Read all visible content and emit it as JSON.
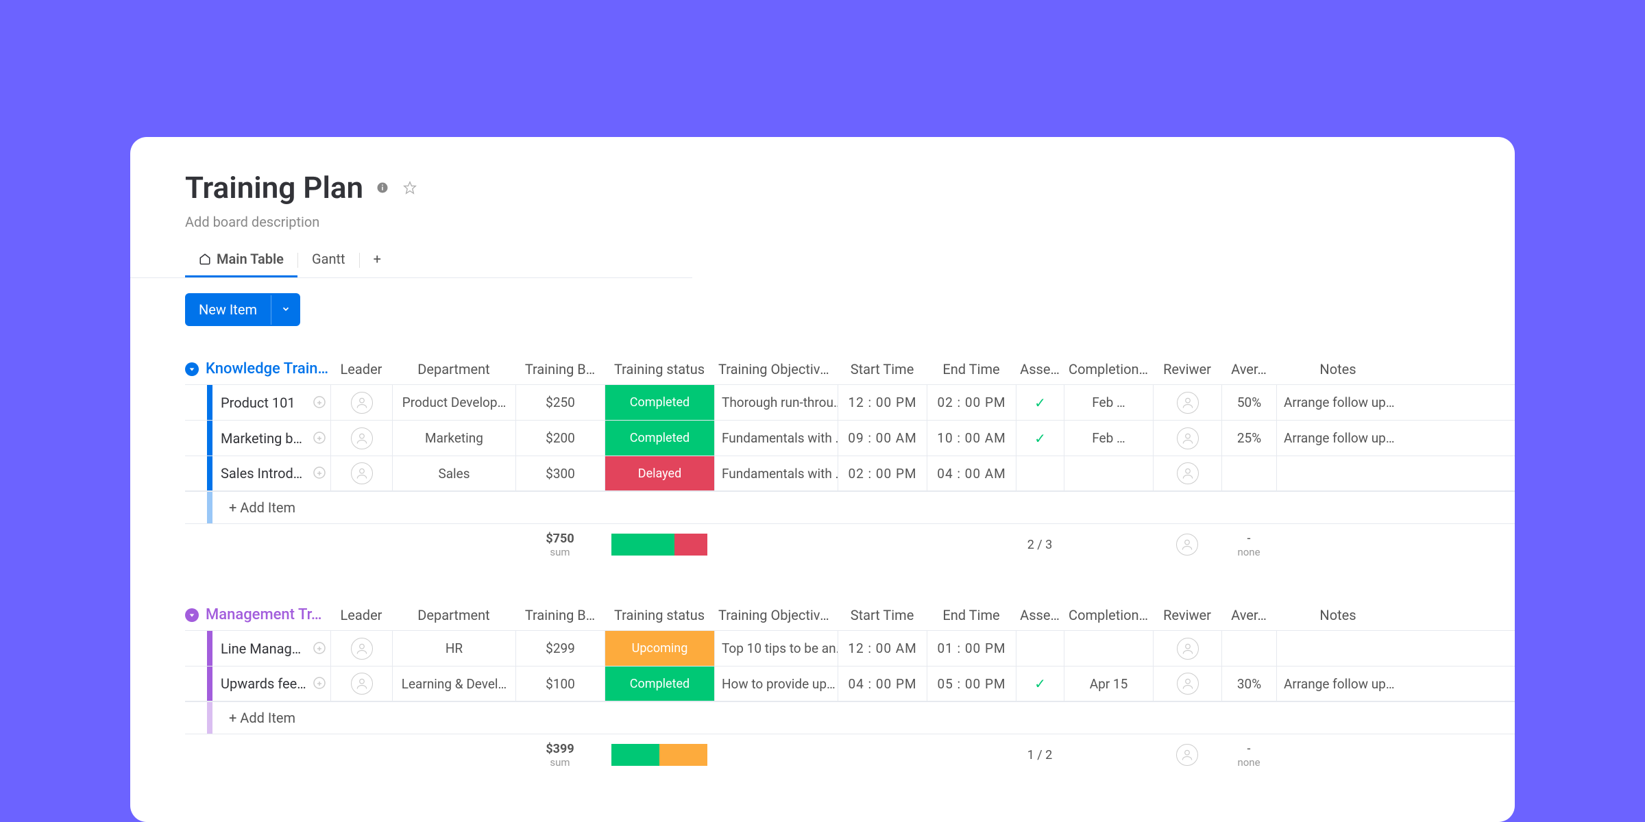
{
  "header": {
    "title": "Training Plan",
    "description_placeholder": "Add board description"
  },
  "tabs": [
    {
      "label": "Main Table",
      "active": true,
      "icon": "home"
    },
    {
      "label": "Gantt",
      "active": false
    }
  ],
  "add_tab_label": "+",
  "actions": {
    "new_item_label": "New Item"
  },
  "columns": [
    "Leader",
    "Department",
    "Training B…",
    "Training status",
    "Training Objectives",
    "Start Time",
    "End Time",
    "Asse…",
    "Completion…",
    "Reviwer",
    "Aver…",
    "Notes"
  ],
  "groups": [
    {
      "title": "Knowledge Train…",
      "color": "#0073ea",
      "collapse_color": "#0073ea",
      "rows": [
        {
          "name": "Product 101",
          "dept": "Product Develop…",
          "budget": "$250",
          "status": {
            "label": "Completed",
            "bg": "#00c875"
          },
          "obj": "Thorough run-throu…",
          "start": "12 : 00 PM",
          "end": "02 : 00 PM",
          "asse": true,
          "comp": "Feb …",
          "aver": "50%",
          "notes": "Arrange follow up…"
        },
        {
          "name": "Marketing b…",
          "dept": "Marketing",
          "budget": "$200",
          "status": {
            "label": "Completed",
            "bg": "#00c875"
          },
          "obj": "Fundamentals with …",
          "start": "09 : 00 AM",
          "end": "10 : 00 AM",
          "asse": true,
          "comp": "Feb …",
          "aver": "25%",
          "notes": "Arrange follow up…"
        },
        {
          "name": "Sales Introd…",
          "dept": "Sales",
          "budget": "$300",
          "status": {
            "label": "Delayed",
            "bg": "#e2445c"
          },
          "obj": "Fundamentals with …",
          "start": "02 : 00 PM",
          "end": "04 : 00 AM",
          "asse": false,
          "comp": "",
          "aver": "",
          "notes": ""
        }
      ],
      "add_item_label": "+ Add Item",
      "summary": {
        "budget": "$750",
        "budget_sub": "sum",
        "status_segments": [
          {
            "bg": "#00c875",
            "pct": 66
          },
          {
            "bg": "#e2445c",
            "pct": 34
          }
        ],
        "asse": "2 / 3",
        "aver": "-",
        "aver_sub": "none"
      }
    },
    {
      "title": "Management Tr…",
      "color": "#a25ddc",
      "collapse_color": "#a25ddc",
      "rows": [
        {
          "name": "Line Manag…",
          "dept": "HR",
          "budget": "$299",
          "status": {
            "label": "Upcoming",
            "bg": "#fdab3d"
          },
          "obj": "Top 10 tips to be an…",
          "start": "12 : 00 AM",
          "end": "01 : 00 PM",
          "asse": false,
          "comp": "",
          "aver": "",
          "notes": ""
        },
        {
          "name": "Upwards fee…",
          "dept": "Learning & Devel…",
          "budget": "$100",
          "status": {
            "label": "Completed",
            "bg": "#00c875"
          },
          "obj": "How to provide up…",
          "start": "04 : 00 PM",
          "end": "05 : 00 PM",
          "asse": true,
          "comp": "Apr 15",
          "aver": "30%",
          "notes": "Arrange follow up…"
        }
      ],
      "add_item_label": "+ Add Item",
      "summary": {
        "budget": "$399",
        "budget_sub": "sum",
        "status_segments": [
          {
            "bg": "#00c875",
            "pct": 50
          },
          {
            "bg": "#fdab3d",
            "pct": 50
          }
        ],
        "asse": "1 / 2",
        "aver": "-",
        "aver_sub": "none"
      }
    }
  ]
}
